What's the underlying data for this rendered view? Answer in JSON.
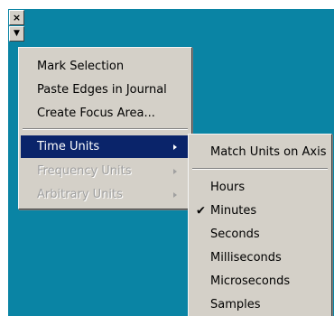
{
  "toolbar": {
    "close_glyph": "×",
    "menu_glyph": "▼"
  },
  "main_menu": {
    "items": [
      {
        "label": "Mark Selection"
      },
      {
        "label": "Paste Edges in Journal"
      },
      {
        "label": "Create Focus Area..."
      },
      {
        "label": "Time Units",
        "highlighted": true
      },
      {
        "label": "Frequency Units",
        "disabled": true
      },
      {
        "label": "Arbitrary Units",
        "disabled": true
      }
    ]
  },
  "sub_menu": {
    "items": [
      {
        "label": "Match Units on Axis"
      },
      {
        "label": "Hours"
      },
      {
        "label": "Minutes",
        "checked": true
      },
      {
        "label": "Seconds"
      },
      {
        "label": "Milliseconds"
      },
      {
        "label": "Microseconds"
      },
      {
        "label": "Samples"
      }
    ],
    "check_glyph": "✔"
  },
  "colors": {
    "canvas": "#0a84a4",
    "menu_bg": "#d4d0c8",
    "highlight": "#0a246a"
  }
}
